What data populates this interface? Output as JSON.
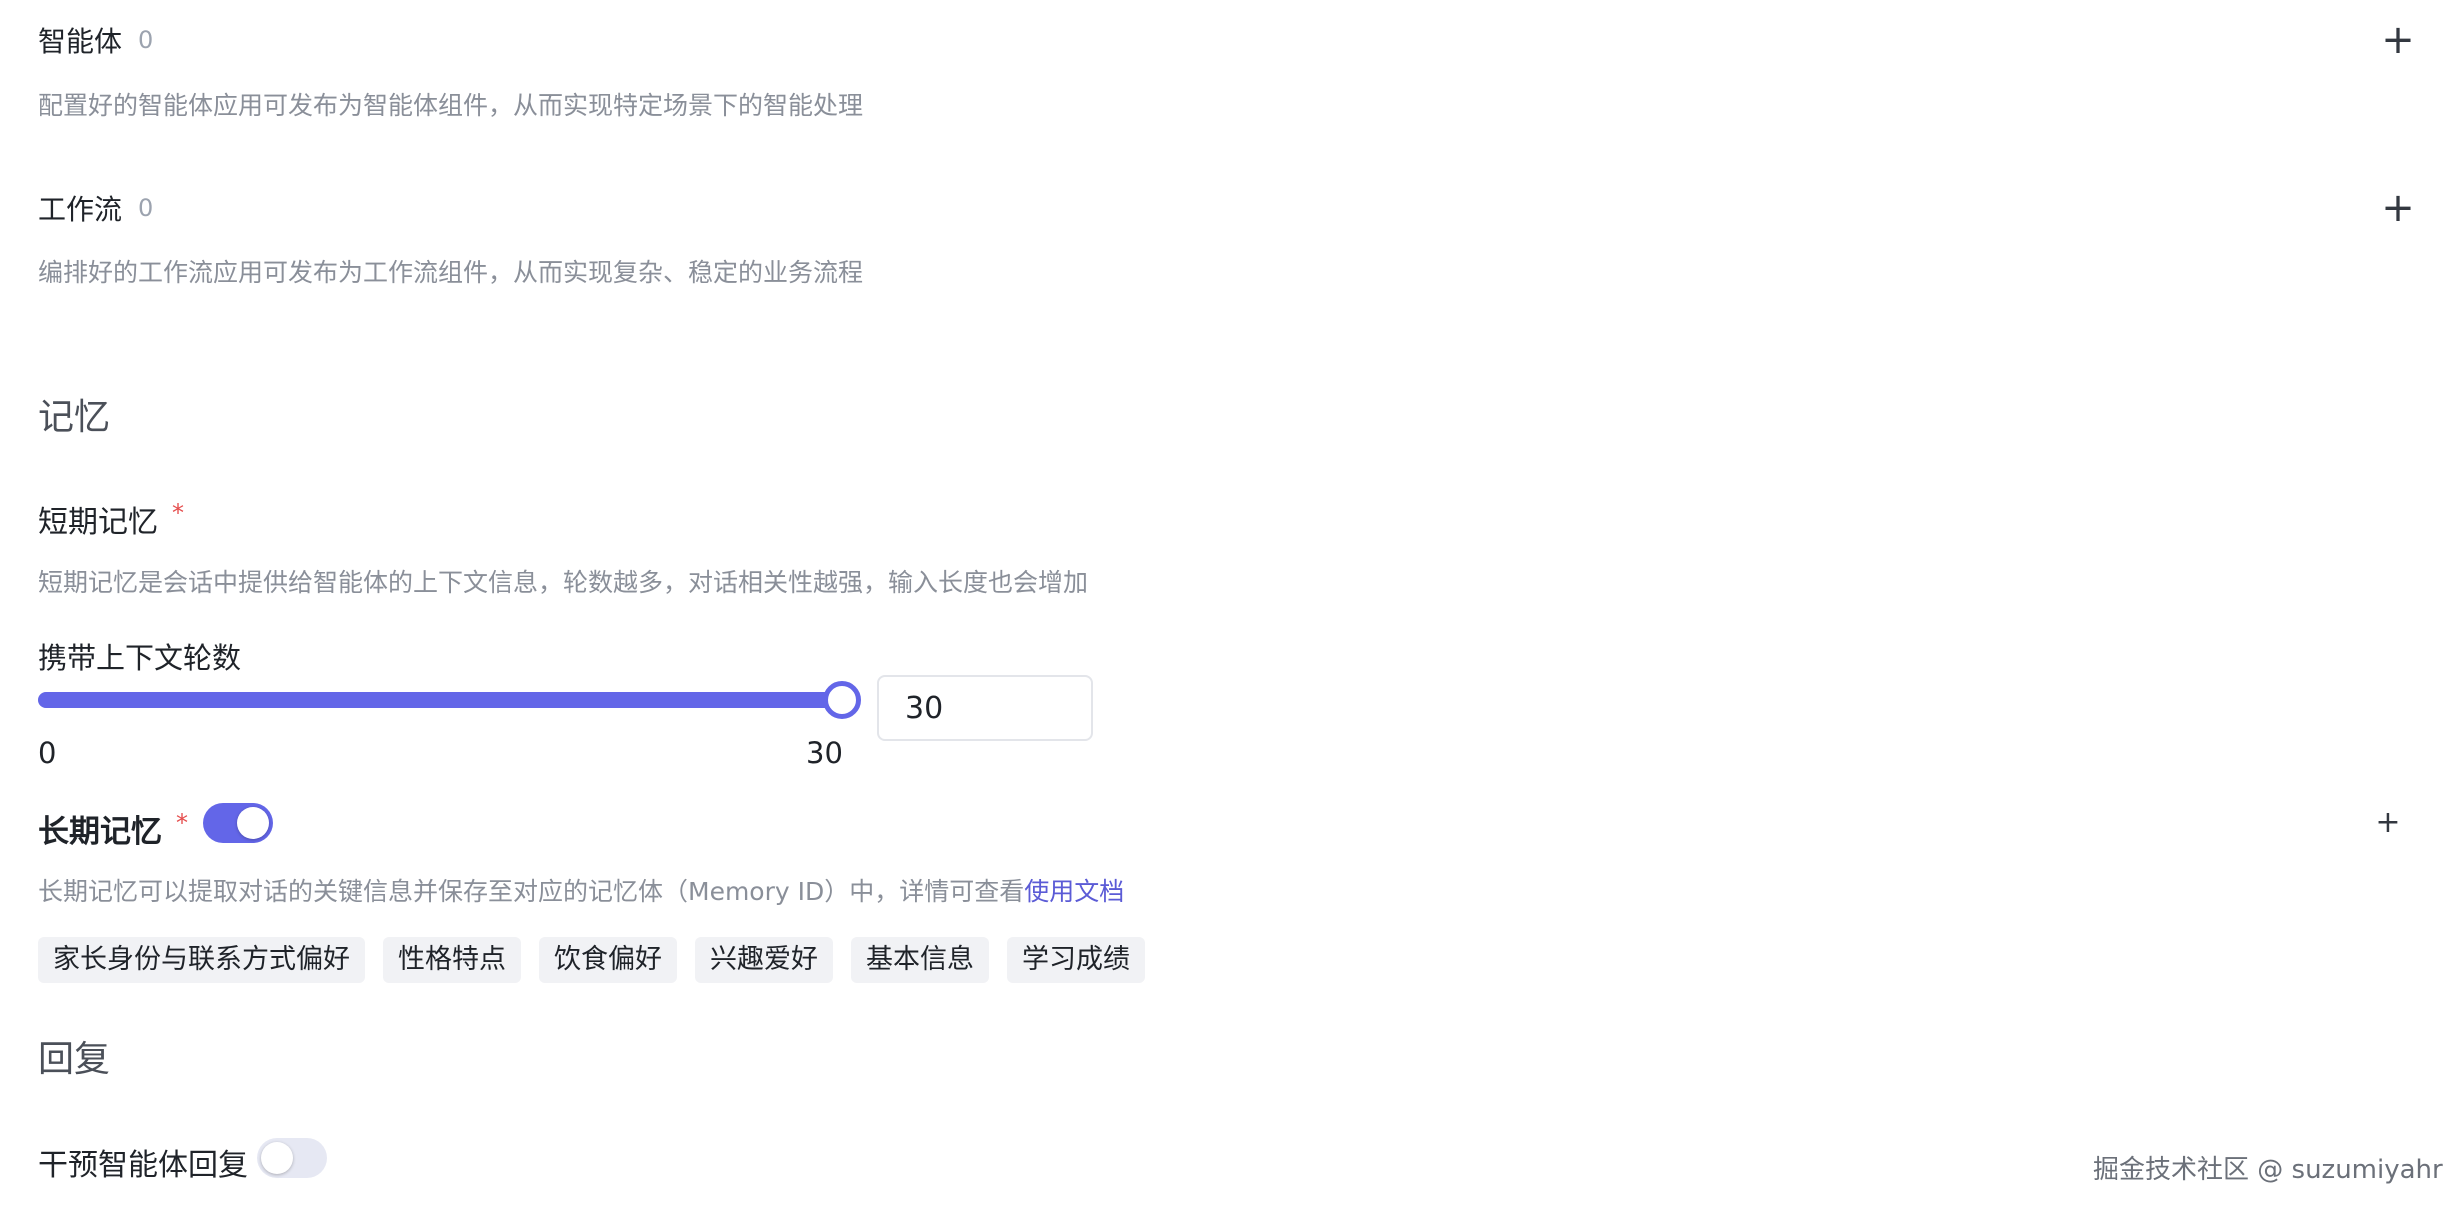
{
  "agents": {
    "title": "智能体",
    "count": "0",
    "description": "配置好的智能体应用可发布为智能体组件，从而实现特定场景下的智能处理",
    "add_icon": "plus-icon"
  },
  "workflows": {
    "title": "工作流",
    "count": "0",
    "description": "编排好的工作流应用可发布为工作流组件，从而实现复杂、稳定的业务流程",
    "add_icon": "plus-icon"
  },
  "memory": {
    "section_title": "记忆",
    "short_term": {
      "title": "短期记忆",
      "required_mark": "*",
      "description": "短期记忆是会话中提供给智能体的上下文信息，轮数越多，对话相关性越强，输入长度也会增加",
      "slider_label": "携带上下文轮数",
      "slider_min": "0",
      "slider_max": "30",
      "slider_value": 30,
      "input_value": "30"
    },
    "long_term": {
      "title": "长期记忆",
      "required_mark": "*",
      "enabled": true,
      "description": "长期记忆可以提取对话的关键信息并保存至对应的记忆体（Memory ID）中，详情可查看",
      "doc_link": "使用文档",
      "tags": [
        "家长身份与联系方式偏好",
        "性格特点",
        "饮食偏好",
        "兴趣爱好",
        "基本信息",
        "学习成绩"
      ],
      "add_icon": "plus-icon"
    }
  },
  "reply": {
    "section_title": "回复",
    "intervene_title": "干预智能体回复",
    "intervene_enabled": false
  },
  "watermark": "掘金技术社区 @ suzumiyahr",
  "colors": {
    "accent": "#6366e8",
    "required": "#e54d4d",
    "description": "#8a8f99",
    "tag_bg": "#f1f2f5"
  }
}
